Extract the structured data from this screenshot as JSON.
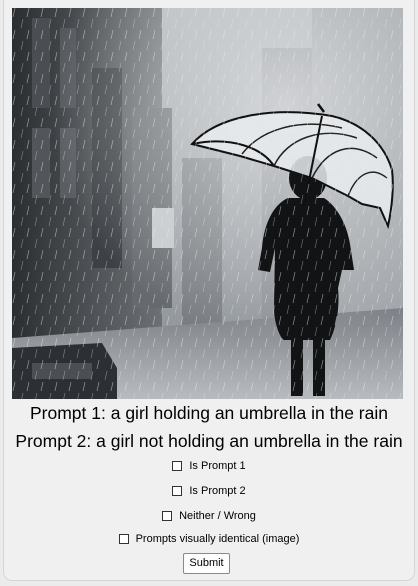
{
  "photo": {
    "alt_subject": "girl-with-umbrella-in-rain-photo"
  },
  "prompts": {
    "prompt1": "Prompt 1: a girl holding an umbrella in the rain",
    "prompt2": "Prompt 2: a girl not holding an umbrella in the rain"
  },
  "options": {
    "is_prompt_1": "Is Prompt 1",
    "is_prompt_2": "Is Prompt 2",
    "neither": "Neither / Wrong",
    "identical": "Prompts visually identical (image)"
  },
  "options_state": {
    "is_prompt_1": false,
    "is_prompt_2": false,
    "neither": false,
    "identical": false
  },
  "submit_label": "Submit",
  "colors": {
    "window_bg": "#f0f0f0",
    "outer_bg": "#ebebeb",
    "button_border": "#8a8a8a"
  }
}
